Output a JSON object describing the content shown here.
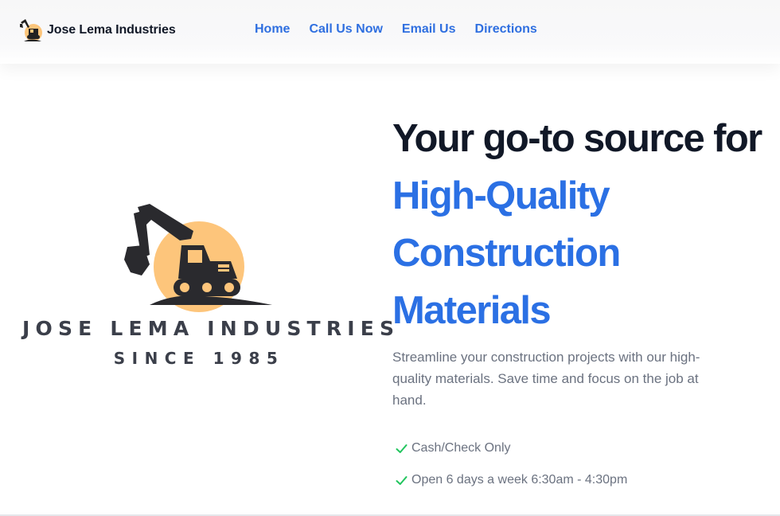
{
  "navbar": {
    "brand_name": "Jose Lema Industries",
    "links": [
      {
        "label": "Home"
      },
      {
        "label": "Call Us Now"
      },
      {
        "label": "Email Us"
      },
      {
        "label": "Directions"
      }
    ]
  },
  "hero": {
    "logo": {
      "company_text": "JOSE LEMA INDUSTRIES",
      "since_text": "SINCE 1985",
      "icon": "excavator-icon"
    },
    "headline_lines": [
      "Your go-to source for",
      "High-Quality",
      "Construction",
      "Materials"
    ],
    "description": "Streamline your construction projects with our high-quality materials. Save time and focus on the job at hand.",
    "features": [
      {
        "icon": "check-icon",
        "text": "Cash/Check Only"
      },
      {
        "icon": "check-icon",
        "text": "Open 6 days a week 6:30am - 4:30pm"
      }
    ]
  },
  "colors": {
    "accent_blue": "#2b70e4",
    "nav_link": "#2f6fe0",
    "text_dark": "#111827",
    "text_muted": "#6b7280",
    "check_green": "#22c55e",
    "logo_sun": "#fdc57b",
    "logo_dark": "#2a2a2e"
  }
}
